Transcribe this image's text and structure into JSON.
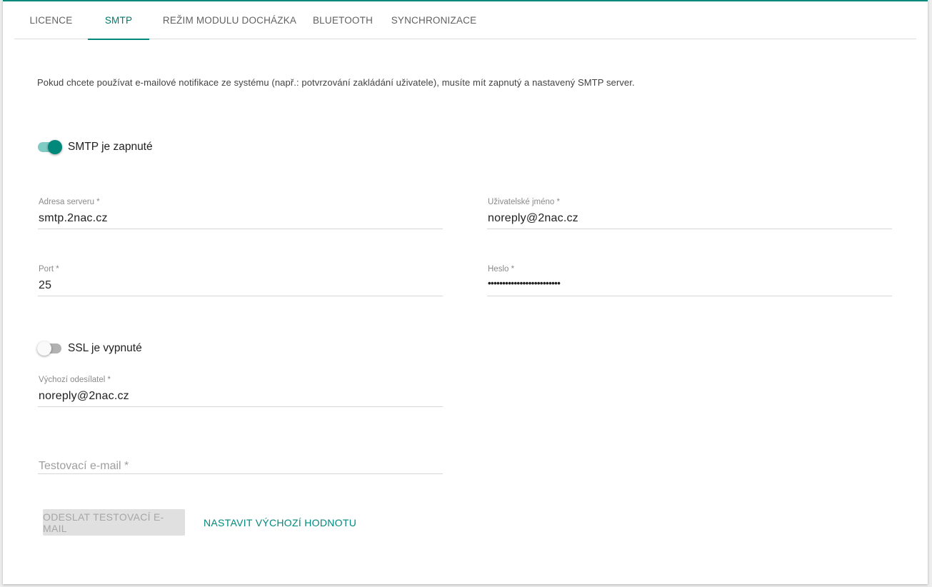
{
  "tabs": [
    {
      "label": "LICENCE"
    },
    {
      "label": "SMTP"
    },
    {
      "label": "REŽIM MODULU DOCHÁZKA"
    },
    {
      "label": "BLUETOOTH"
    },
    {
      "label": "SYNCHRONIZACE"
    }
  ],
  "active_tab": "SMTP",
  "info_text": "Pokud chcete používat e-mailové notifikace ze systému (např.: potvrzování zakládání uživatele), musíte mít zapnutý a nastavený SMTP server.",
  "smtp_toggle": {
    "label": "SMTP je zapnuté",
    "on": true
  },
  "server_address": {
    "label": "Adresa serveru *",
    "value": "smtp.2nac.cz"
  },
  "username": {
    "label": "Uživatelské jméno *",
    "value": "noreply@2nac.cz"
  },
  "port": {
    "label": "Port *",
    "value": "25"
  },
  "password": {
    "label": "Heslo *",
    "value": "•••••••••••••••••••••••••"
  },
  "ssl_toggle": {
    "label": "SSL je vypnuté",
    "on": false
  },
  "default_sender": {
    "label": "Výchozí odesílatel *",
    "value": "noreply@2nac.cz"
  },
  "test_email": {
    "placeholder": "Testovací e-mail *",
    "value": ""
  },
  "buttons": {
    "send_test": "ODESLAT TESTOVACÍ E-MAIL",
    "set_default": "NASTAVIT VÝCHOZÍ HODNOTU"
  },
  "colors": {
    "accent": "#00897b",
    "disabled_bg": "#e0e0e0"
  }
}
